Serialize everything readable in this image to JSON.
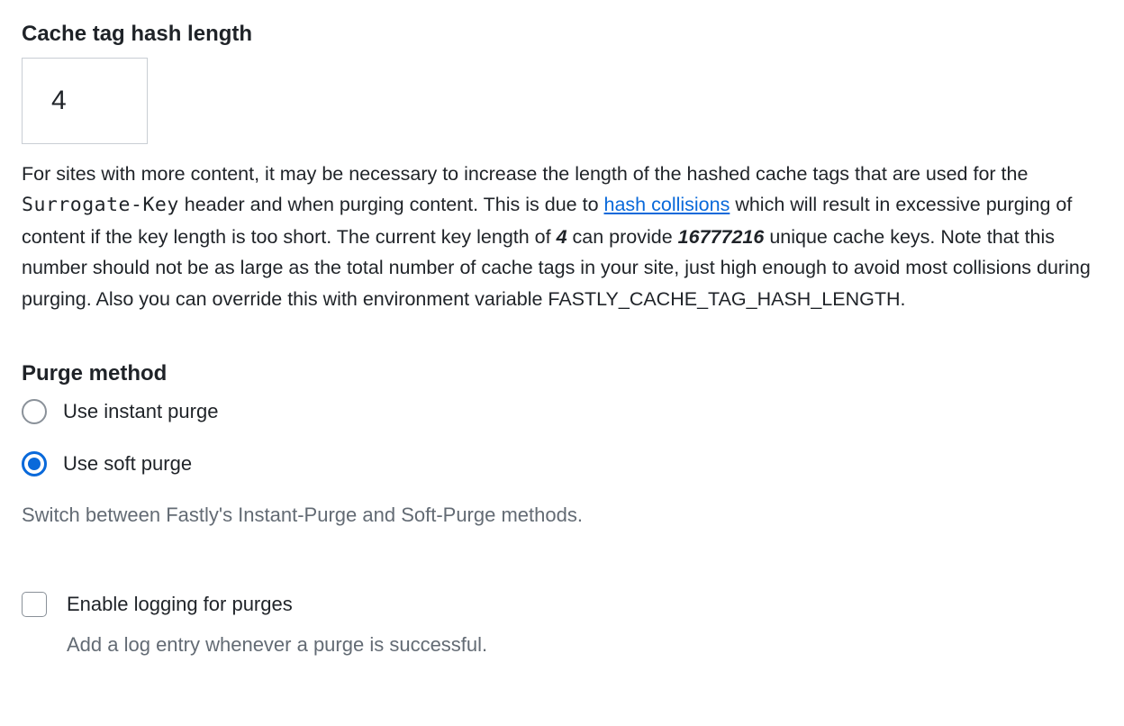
{
  "hash_length": {
    "label": "Cache tag hash length",
    "value": "4",
    "desc_part1": "For sites with more content, it may be necessary to increase the length of the hashed cache tags that are used for the ",
    "desc_surrogate": "Surrogate-Key",
    "desc_part2": " header and when purging content. This is due to ",
    "desc_link": "hash collisions",
    "desc_part3": " which will result in excessive purging of content if the key length is too short. The current key length of ",
    "desc_keylen": "4",
    "desc_part4": " can provide ",
    "desc_unique": "16777216",
    "desc_part5": " unique cache keys. Note that this number should not be as large as the total number of cache tags in your site, just high enough to avoid most collisions during purging. Also you can override this with environment variable FASTLY_CACHE_TAG_HASH_LENGTH."
  },
  "purge_method": {
    "label": "Purge method",
    "options": {
      "instant": {
        "label": "Use instant purge",
        "checked": false
      },
      "soft": {
        "label": "Use soft purge",
        "checked": true
      }
    },
    "help": "Switch between Fastly's Instant-Purge and Soft-Purge methods."
  },
  "logging": {
    "label": "Enable logging for purges",
    "checked": false,
    "help": "Add a log entry whenever a purge is successful."
  }
}
